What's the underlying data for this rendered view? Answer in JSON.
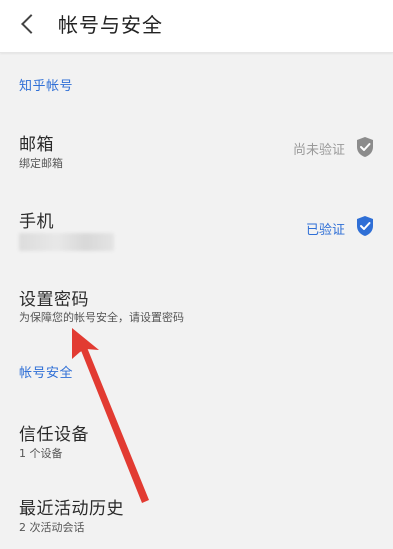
{
  "header": {
    "title": "帐号与安全",
    "back_icon": "chevron-left-icon"
  },
  "sections": {
    "zhihu_account": "知乎帐号",
    "account_security": "帐号安全"
  },
  "rows": {
    "email": {
      "label": "邮箱",
      "sub": "绑定邮箱",
      "status": "尚未验证",
      "status_color": "#9a9a9a",
      "icon": "shield-check-gray-icon"
    },
    "phone": {
      "label": "手机",
      "status": "已验证",
      "status_color": "#2f6fd6",
      "icon": "shield-check-blue-icon"
    },
    "password": {
      "label": "设置密码",
      "sub": "为保障您的帐号安全，请设置密码"
    },
    "trusted_devices": {
      "label": "信任设备",
      "sub": "1 个设备"
    },
    "recent_activity": {
      "label": "最近活动历史",
      "sub": "2 次活动会话"
    }
  },
  "colors": {
    "accent": "#2f6fd6",
    "arrow": "#e23b32",
    "background": "#f2f2f2"
  }
}
